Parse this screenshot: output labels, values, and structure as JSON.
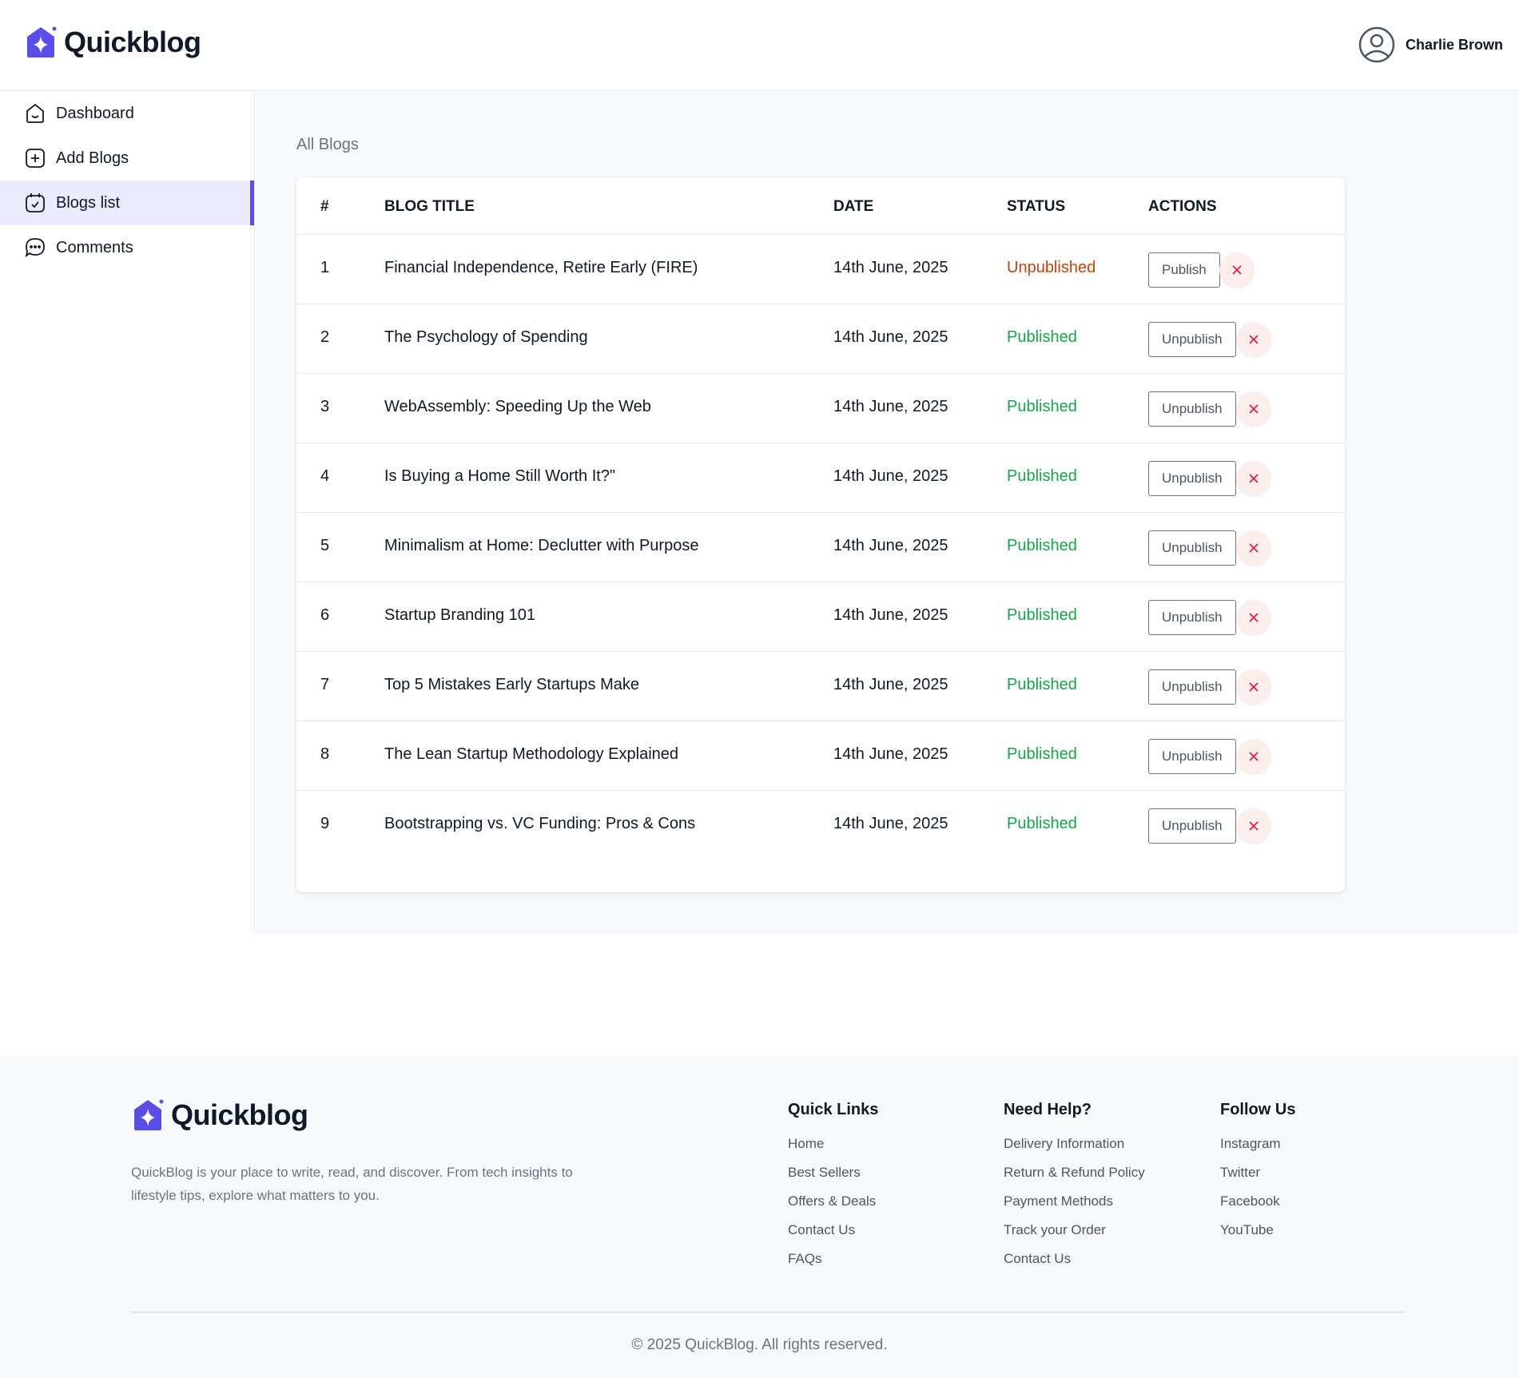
{
  "brand": {
    "name": "Quickblog",
    "accent": "#5b4ee6"
  },
  "header": {
    "user_name": "Charlie Brown"
  },
  "sidebar": {
    "items": [
      {
        "label": "Dashboard",
        "icon": "home-icon"
      },
      {
        "label": "Add Blogs",
        "icon": "add-square-icon"
      },
      {
        "label": "Blogs list",
        "icon": "calendar-check-icon",
        "active": true
      },
      {
        "label": "Comments",
        "icon": "chat-bubble-icon"
      }
    ]
  },
  "main": {
    "title": "All Blogs",
    "columns": [
      "#",
      "BLOG TITLE",
      "DATE",
      "STATUS",
      "ACTIONS"
    ],
    "rows": [
      {
        "num": "1",
        "title": "Financial Independence, Retire Early (FIRE)",
        "date": "14th June, 2025",
        "status": "Unpublished",
        "action": "Publish"
      },
      {
        "num": "2",
        "title": "The Psychology of Spending",
        "date": "14th June, 2025",
        "status": "Published",
        "action": "Unpublish"
      },
      {
        "num": "3",
        "title": "WebAssembly: Speeding Up the Web",
        "date": "14th June, 2025",
        "status": "Published",
        "action": "Unpublish"
      },
      {
        "num": "4",
        "title": "Is Buying a Home Still Worth It?\"",
        "date": "14th June, 2025",
        "status": "Published",
        "action": "Unpublish"
      },
      {
        "num": "5",
        "title": "Minimalism at Home: Declutter with Purpose",
        "date": "14th June, 2025",
        "status": "Published",
        "action": "Unpublish"
      },
      {
        "num": "6",
        "title": "Startup Branding 101",
        "date": "14th June, 2025",
        "status": "Published",
        "action": "Unpublish"
      },
      {
        "num": "7",
        "title": "Top 5 Mistakes Early Startups Make",
        "date": "14th June, 2025",
        "status": "Published",
        "action": "Unpublish"
      },
      {
        "num": "8",
        "title": "The Lean Startup Methodology Explained",
        "date": "14th June, 2025",
        "status": "Published",
        "action": "Unpublish"
      },
      {
        "num": "9",
        "title": "Bootstrapping vs. VC Funding: Pros & Cons",
        "date": "14th June, 2025",
        "status": "Published",
        "action": "Unpublish"
      }
    ]
  },
  "footer": {
    "description": "QuickBlog is your place to write, read, and discover. From tech insights to lifestyle tips, explore what matters to you.",
    "columns": [
      {
        "title": "Quick Links",
        "links": [
          "Home",
          "Best Sellers",
          "Offers & Deals",
          "Contact Us",
          "FAQs"
        ]
      },
      {
        "title": "Need Help?",
        "links": [
          "Delivery Information",
          "Return & Refund Policy",
          "Payment Methods",
          "Track your Order",
          "Contact Us"
        ]
      },
      {
        "title": "Follow Us",
        "links": [
          "Instagram",
          "Twitter",
          "Facebook",
          "YouTube"
        ]
      }
    ],
    "copyright": "© 2025 QuickBlog. All rights reserved."
  }
}
